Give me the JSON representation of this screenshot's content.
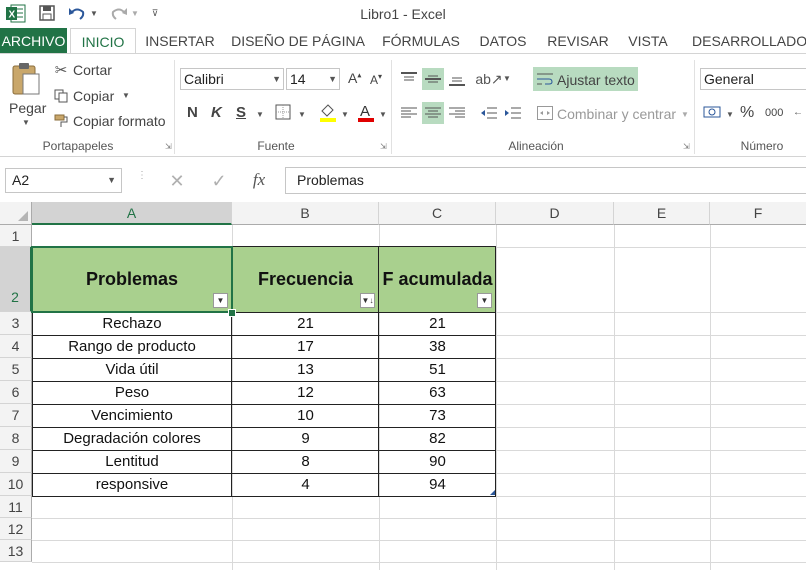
{
  "titlebar": {
    "title": "Libro1 - Excel"
  },
  "tabs": [
    {
      "label": "ARCHIVO"
    },
    {
      "label": "INICIO"
    },
    {
      "label": "INSERTAR"
    },
    {
      "label": "DISEÑO DE PÁGINA"
    },
    {
      "label": "FÓRMULAS"
    },
    {
      "label": "DATOS"
    },
    {
      "label": "REVISAR"
    },
    {
      "label": "VISTA"
    },
    {
      "label": "DESARROLLADOR"
    }
  ],
  "ribbon": {
    "clipboard": {
      "paste": "Pegar",
      "cut": "Cortar",
      "copy": "Copiar",
      "format_painter": "Copiar formato",
      "group": "Portapapeles"
    },
    "font": {
      "name": "Calibri",
      "size": "14",
      "bold": "N",
      "italic": "K",
      "underline": "S",
      "group": "Fuente"
    },
    "alignment": {
      "wrap": "Ajustar texto",
      "merge": "Combinar y centrar",
      "group": "Alineación"
    },
    "number": {
      "format": "General",
      "percent": "%",
      "thousands": "000",
      "group": "Número"
    }
  },
  "formula_bar": {
    "name_box": "A2",
    "fx": "fx",
    "value": "Problemas"
  },
  "grid": {
    "columns": [
      "A",
      "B",
      "C",
      "D",
      "E",
      "F"
    ],
    "rows": [
      "1",
      "2",
      "3",
      "4",
      "5",
      "6",
      "7",
      "8",
      "9",
      "10",
      "11",
      "12",
      "13"
    ],
    "headers": [
      "Problemas",
      "Frecuencia",
      "F acumulada"
    ],
    "data": [
      [
        "Rechazo",
        "21",
        "21"
      ],
      [
        "Rango de producto",
        "17",
        "38"
      ],
      [
        "Vida útil",
        "13",
        "51"
      ],
      [
        "Peso",
        "12",
        "63"
      ],
      [
        "Vencimiento",
        "10",
        "73"
      ],
      [
        "Degradación colores",
        "9",
        "82"
      ],
      [
        "Lentitud",
        "8",
        "90"
      ],
      [
        "responsive",
        "4",
        "94"
      ]
    ]
  },
  "colors": {
    "excel_green": "#217346",
    "header_fill": "#a9d08e",
    "highlight": "#b8dbc0"
  }
}
